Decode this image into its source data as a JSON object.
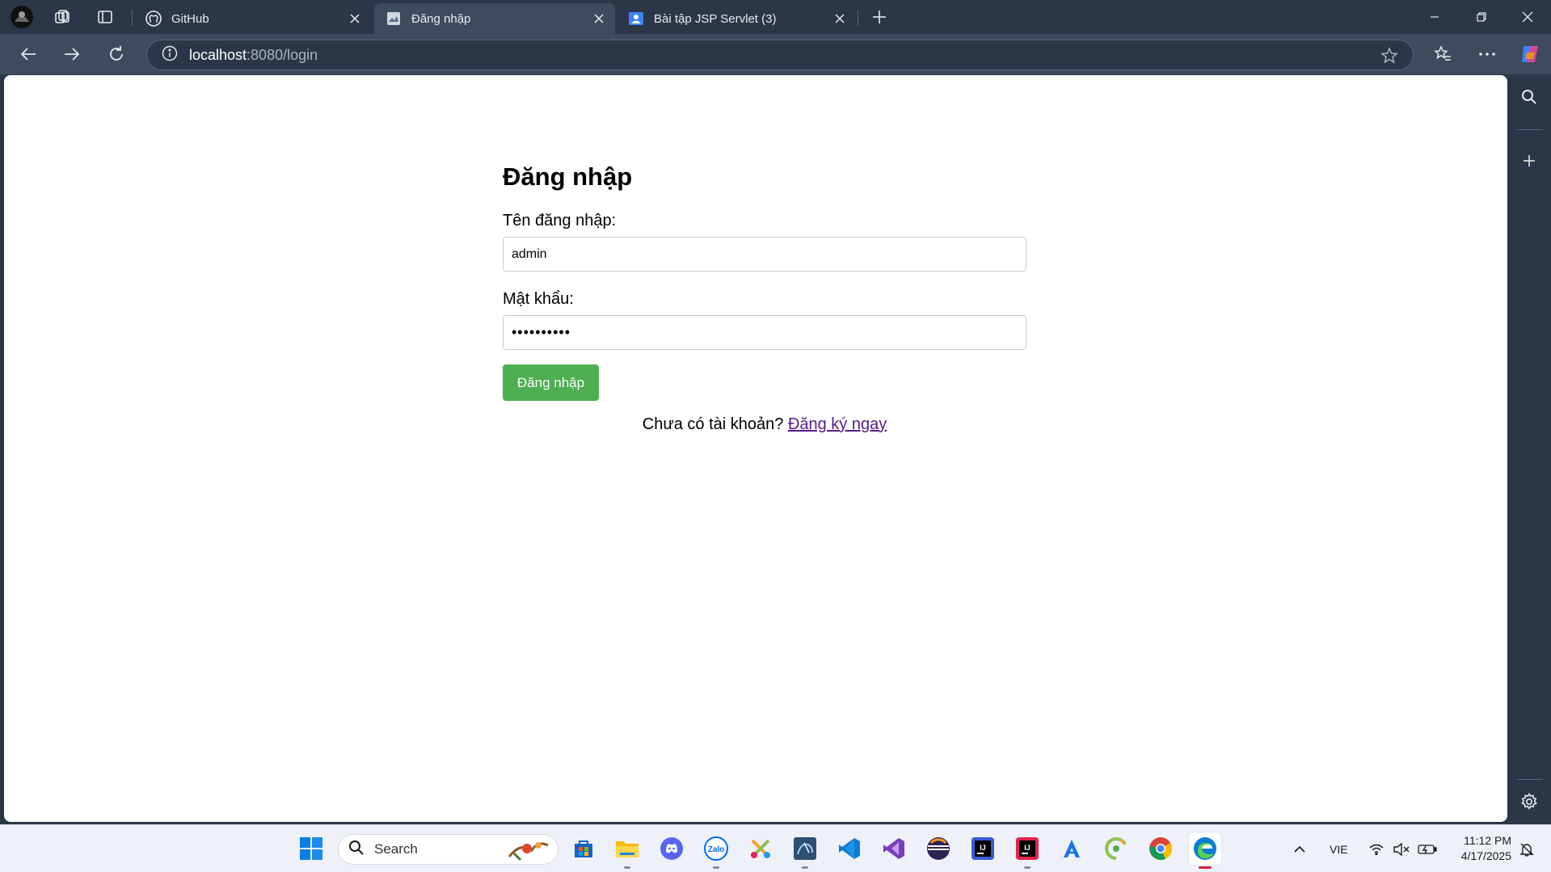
{
  "browser": {
    "tabs": [
      {
        "title": "GitHub",
        "icon": "github-icon",
        "active": false
      },
      {
        "title": "Đăng nhập",
        "icon": "page-icon",
        "active": true
      },
      {
        "title": "Bài tập JSP Servlet (3)",
        "icon": "contacts-icon",
        "active": false
      }
    ],
    "address": {
      "host": "localhost",
      "rest": ":8080/login"
    }
  },
  "page": {
    "heading": "Đăng nhập",
    "username_label": "Tên đăng nhập:",
    "username_value": "admin",
    "password_label": "Mật khẩu:",
    "password_value": "••••••••••",
    "submit_label": "Đăng nhập",
    "register_prompt": "Chưa có tài khoản?",
    "register_link": "Đăng ký ngay"
  },
  "taskbar": {
    "search_label": "Search",
    "language": "VIE",
    "time": "11:12 PM",
    "date": "4/17/2025"
  },
  "colors": {
    "accent_button": "#4caf50",
    "visited_link": "#551a8b",
    "browser_frame": "#2b3648",
    "active_tab": "#3e4a5e"
  }
}
